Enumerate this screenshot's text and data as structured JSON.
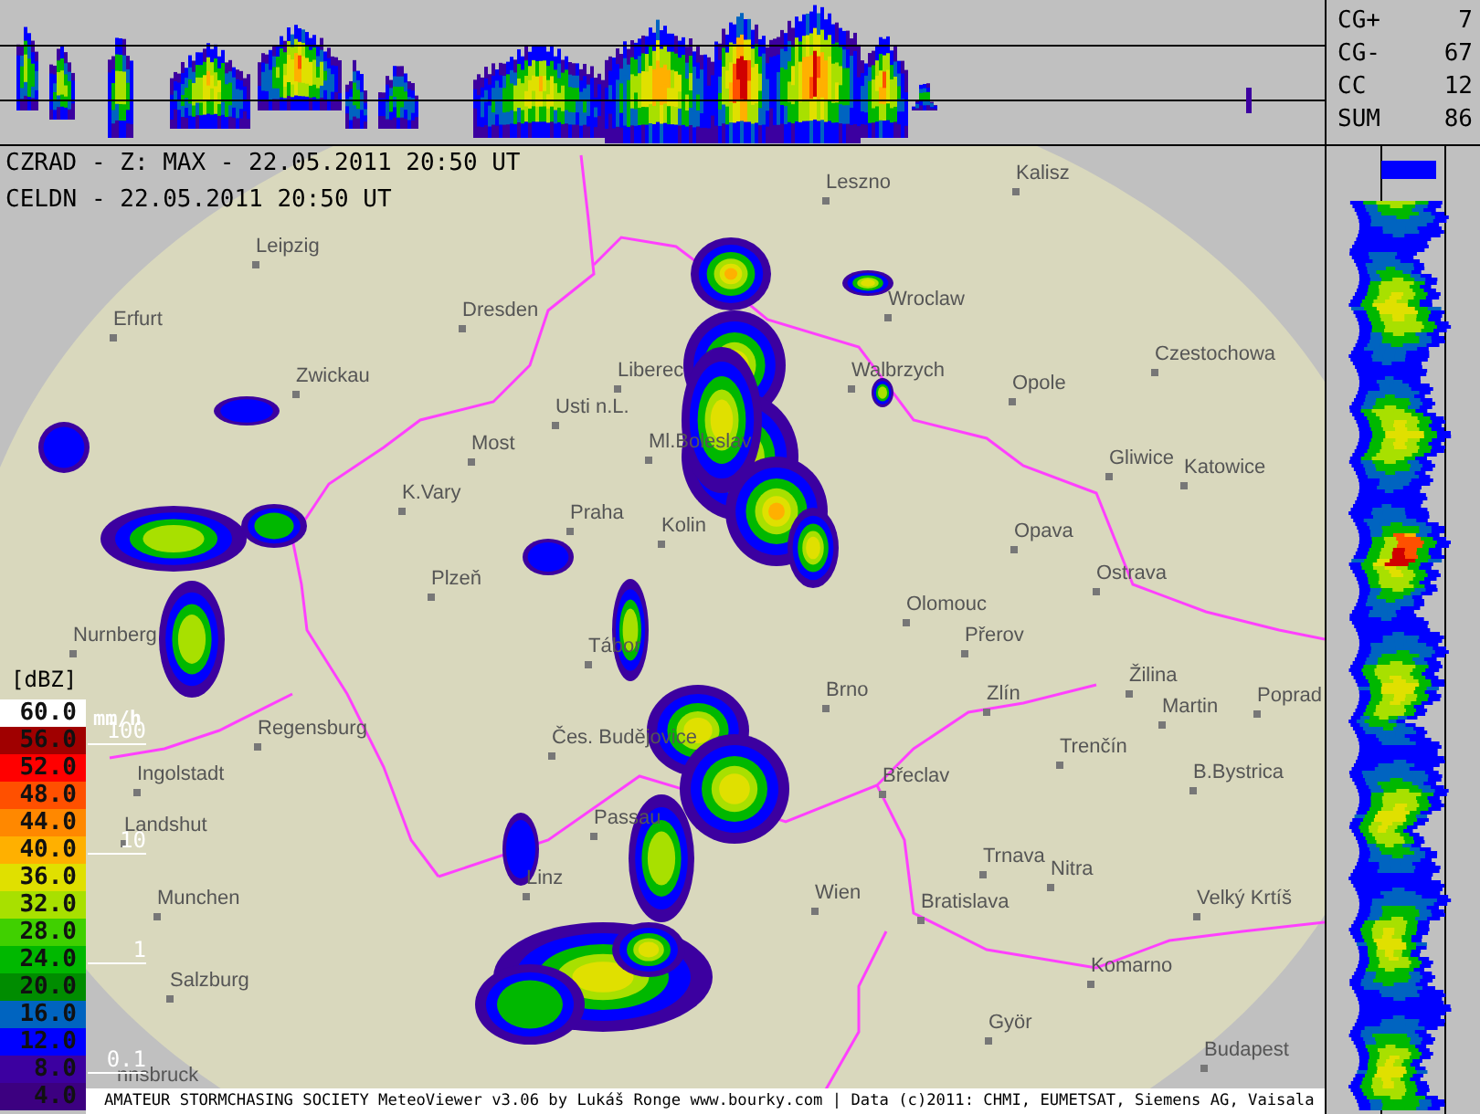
{
  "lightning_counts": [
    {
      "label": "CG+",
      "value": "7"
    },
    {
      "label": "CG-",
      "value": "67"
    },
    {
      "label": "CC",
      "value": "12"
    },
    {
      "label": "SUM",
      "value": "86"
    }
  ],
  "header": [
    "CZRAD - Z: MAX - 22.05.2011 20:50 UT",
    "CELDN - 22.05.2011 20:50 UT"
  ],
  "cities": [
    "Leszno",
    "Kalisz",
    "Leipzig",
    "Erfurt",
    "Dresden",
    "Wroclaw",
    "Opole",
    "Czestochowa",
    "Zwickau",
    "Liberec",
    "Usti n.L.",
    "Walbrzych",
    "Most",
    "Ml.Boleslav",
    "K.Vary",
    "Praha",
    "Kolin",
    "Gliwice",
    "Katowice",
    "Opava",
    "Ostrava",
    "Plzeň",
    "Olomouc",
    "Přerov",
    "Tábor",
    "Brno",
    "Zlín",
    "Žilina",
    "Martin",
    "Poprad",
    "Nurnberg",
    "Regensburg",
    "Čes. Budějovice",
    "Ingolstadt",
    "Břeclav",
    "Trenčín",
    "B.Bystrica",
    "Passau",
    "Landshut",
    "Trnava",
    "Nitra",
    "Munchen",
    "Linz",
    "Wien",
    "Bratislava",
    "Velký Krtíš",
    "Komarno",
    "Salzburg",
    "Györ",
    "Budapest",
    "nnsbruck"
  ],
  "legend": {
    "unit": "[dBZ]",
    "levels": [
      {
        "value": "60.0",
        "color": "#ffffff"
      },
      {
        "value": "56.0",
        "color": "#a00000"
      },
      {
        "value": "52.0",
        "color": "#ff0000"
      },
      {
        "value": "48.0",
        "color": "#ff5000"
      },
      {
        "value": "44.0",
        "color": "#ff8800"
      },
      {
        "value": "40.0",
        "color": "#ffb000"
      },
      {
        "value": "36.0",
        "color": "#e0e000"
      },
      {
        "value": "32.0",
        "color": "#a8e000"
      },
      {
        "value": "28.0",
        "color": "#40d000"
      },
      {
        "value": "24.0",
        "color": "#00b800"
      },
      {
        "value": "20.0",
        "color": "#008c00"
      },
      {
        "value": "16.0",
        "color": "#0064c0"
      },
      {
        "value": "12.0",
        "color": "#0000ff"
      },
      {
        "value": "8.0",
        "color": "#3c00a0"
      },
      {
        "value": "4.0",
        "color": "#3c0080"
      }
    ],
    "rain_unit": "mm/h",
    "rain_marks": [
      "100",
      "10",
      "1",
      "0.1"
    ]
  },
  "footer": "AMATEUR STORMCHASING SOCIETY MeteoViewer v3.06 by Lukáš Ronge www.bourky.com | Data (c)2011: CHMI, EUMETSAT, Siemens AG, Vaisala"
}
